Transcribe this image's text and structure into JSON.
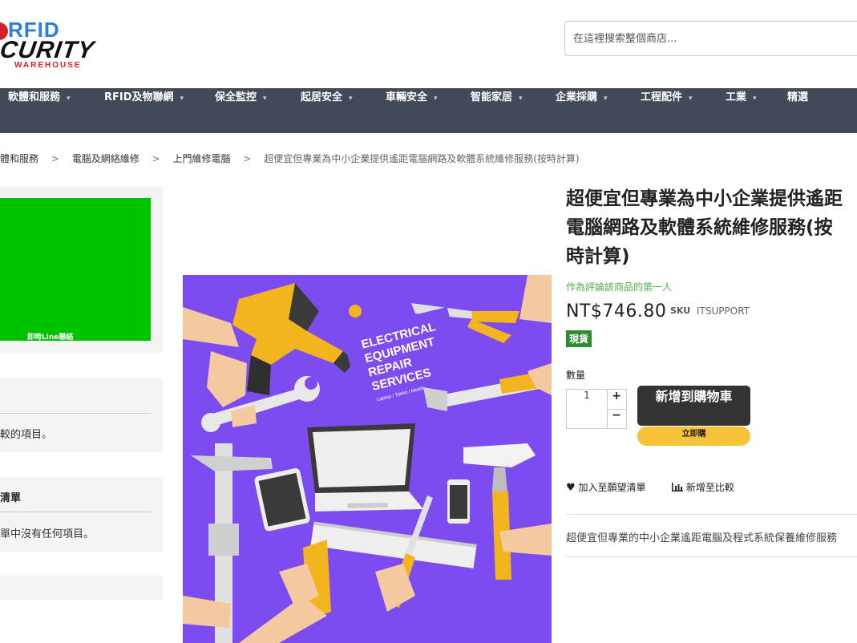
{
  "header": {
    "logo": {
      "line1": "RFID",
      "line2": "CURITY",
      "line3": "WAREHOUSE"
    },
    "search": {
      "placeholder": "在這裡搜索整個商店..."
    }
  },
  "nav": {
    "items": [
      {
        "label": "軟體和服務",
        "caret": "▾"
      },
      {
        "label": "RFID及物聯網",
        "caret": "▾"
      },
      {
        "label": "保全監控",
        "caret": "▾"
      },
      {
        "label": "起居安全",
        "caret": "▾"
      },
      {
        "label": "車輛安全",
        "caret": "▾"
      },
      {
        "label": "智能家居",
        "caret": "▾"
      },
      {
        "label": "企業採購",
        "caret": "▾"
      },
      {
        "label": "工程配件",
        "caret": "▾"
      },
      {
        "label": "工業",
        "caret": "▾"
      },
      {
        "label": "精選",
        "caret": ""
      }
    ]
  },
  "breadcrumb": {
    "items": [
      "體和服務",
      "電腦及網絡維修",
      "上門維修電腦"
    ],
    "current": "超便宜但專業為中小企業提供遙距電腦網路及軟體系統維修服務(按時計算)",
    "separator": ">"
  },
  "sidebar": {
    "line_banner": "即時Line聯絡",
    "compare": {
      "text": "較的項目。"
    },
    "wishlist": {
      "title": "清單",
      "text": "單中沒有任何項目。"
    }
  },
  "product": {
    "image_alt": "ELECTRICAL EQUIPMENT REPAIR SERVICES",
    "image_text": [
      "ELECTRICAL",
      "EQUIPMENT",
      "REPAIR",
      "SERVICES"
    ],
    "image_subtext": "Laptop / Tablet / Mobile",
    "title": "超便宜但專業為中小企業提供遙距電腦網路及軟體系統維修服務(按時計算)",
    "review_link": "作為評論該商品的第一人",
    "price": "NT$746.80",
    "sku_label": "SKU",
    "sku_value": "ITSUPPORT",
    "stock": "現貨",
    "qty_label": "數量",
    "qty_value": "1",
    "qty_plus": "+",
    "qty_minus": "−",
    "add_to_cart": "新增到購物車",
    "buy_now": "立即購",
    "wishlist_label": "加入至願望清單",
    "compare_label": "新增至比較",
    "short_description": "超便宜但專業的中小企業遙距電腦及程式系統保養維修服務"
  },
  "colors": {
    "nav_bg": "#424a5a",
    "line_green": "#00c300",
    "stock_badge": "#2e8b2e",
    "buy_now": "#f5c23a",
    "image_bg": "#7d4cf0"
  }
}
